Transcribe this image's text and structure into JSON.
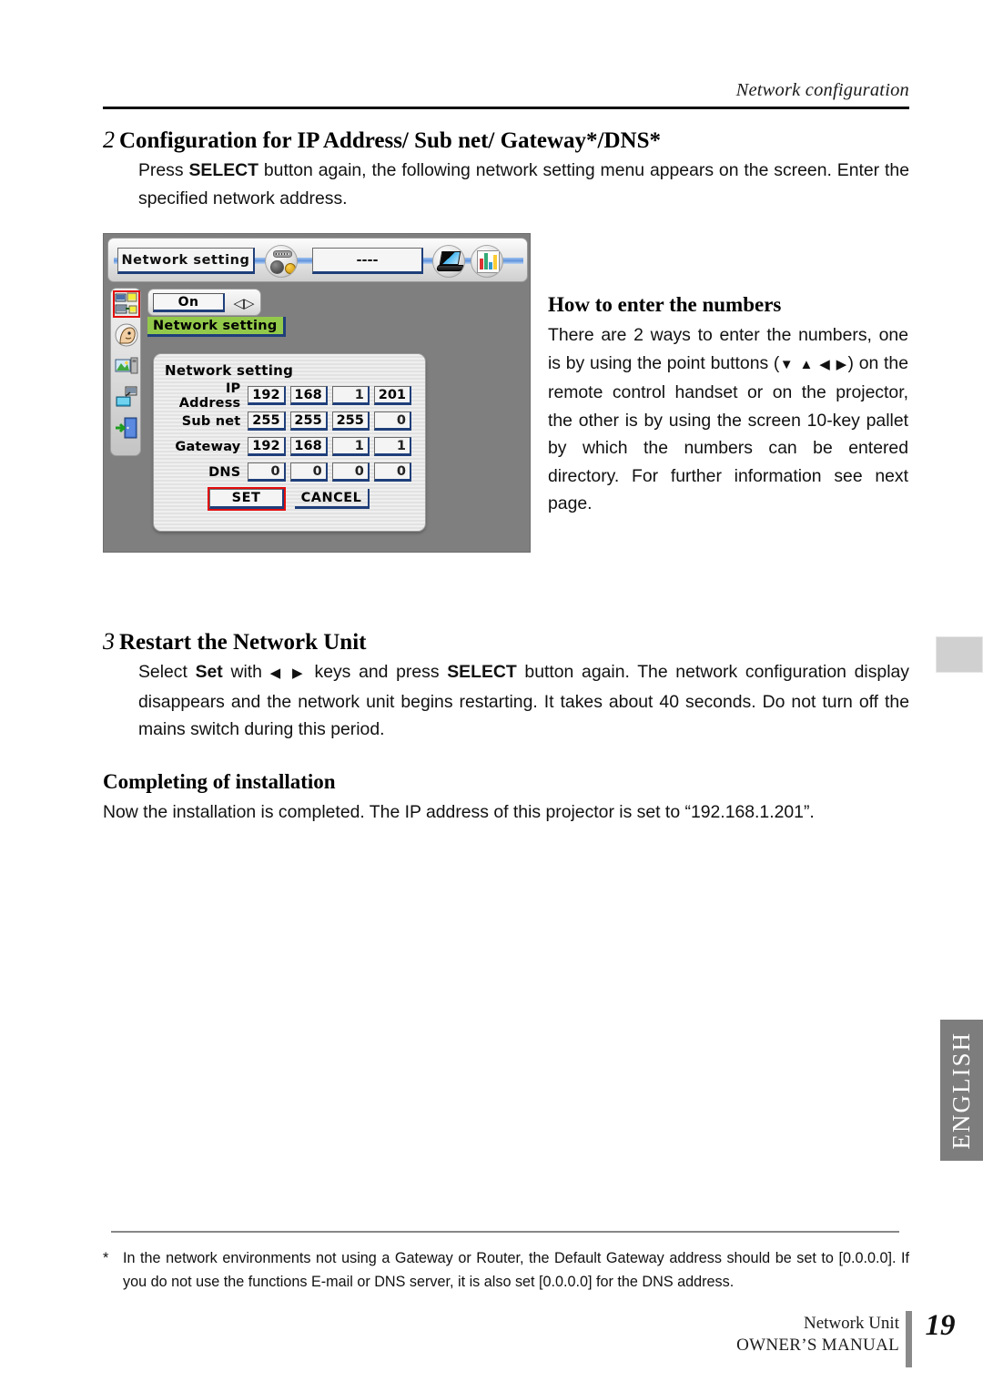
{
  "page": {
    "running_head": "Network configuration",
    "page_number": "19"
  },
  "section2": {
    "number": "2",
    "title": "Configuration for IP Address/ Sub net/ Gateway*/DNS*",
    "body": "Press SELECT button again, the following network setting menu appears on the screen. Enter the specified network address.",
    "body_bold_term": "SELECT"
  },
  "howto": {
    "title": "How to enter the numbers",
    "body_part1": "There are 2 ways to enter the numbers, one is by using the point buttons (",
    "arrows": "▼ ▲ ◀ ▶",
    "body_part2": ") on the remote control handset or on the projector, the other is by using the screen 10-key pallet by which the numbers can be entered directory. For further information see next page."
  },
  "section3": {
    "number": "3",
    "title": "Restart the Network Unit",
    "body_part1": "Select ",
    "body_set": "Set",
    "body_part2": " with ",
    "arrows": "◀ ▶",
    "body_part3": " keys and press ",
    "body_select": "SELECT",
    "body_part4": " button again. The network configuration display disappears and the network unit begins restarting. It takes about 40 seconds. Do not turn off the mains switch during this period."
  },
  "completing": {
    "title": "Completing of installation",
    "body": "Now the installation is completed. The IP address of this projector is set to “192.168.1.201”."
  },
  "footnote": {
    "marker": "*",
    "text": "In the network environments not using a Gateway or Router, the Default Gateway address should be set to [0.0.0.0]. If you do not use the functions E-mail or DNS server, it is also set [0.0.0.0] for the DNS address."
  },
  "footer": {
    "product": "Network Unit",
    "manual": "OWNER’S MANUAL"
  },
  "side_tab": {
    "language": "ENGLISH"
  },
  "figure": {
    "toolbar": {
      "title": "Network setting",
      "status_field": "----",
      "icons": [
        "io-port-icon",
        "laptop-icon",
        "color-bars-icon"
      ]
    },
    "rail_icons": [
      "network-computers-icon",
      "user-profile-icon",
      "image-display-icon",
      "computer-link-icon",
      "exit-door-icon"
    ],
    "toggle": {
      "value": "On",
      "arrows": "◁▷"
    },
    "highlight_label": "Network setting",
    "dialog": {
      "title": "Network setting",
      "rows": [
        {
          "label": "IP Address",
          "octets": [
            "192",
            "168",
            "1",
            "201"
          ]
        },
        {
          "label": "Sub net",
          "octets": [
            "255",
            "255",
            "255",
            "0"
          ]
        },
        {
          "label": "Gateway",
          "octets": [
            "192",
            "168",
            "1",
            "1"
          ]
        },
        {
          "label": "DNS",
          "octets": [
            "0",
            "0",
            "0",
            "0"
          ]
        }
      ],
      "set_button": "SET",
      "cancel_button": "CANCEL"
    },
    "colors": {
      "background": "#7f7f7f",
      "highlight_green": "#93c94a",
      "selection_red": "#e20d0d",
      "field_shadow_blue": "#1f3f7a"
    }
  }
}
